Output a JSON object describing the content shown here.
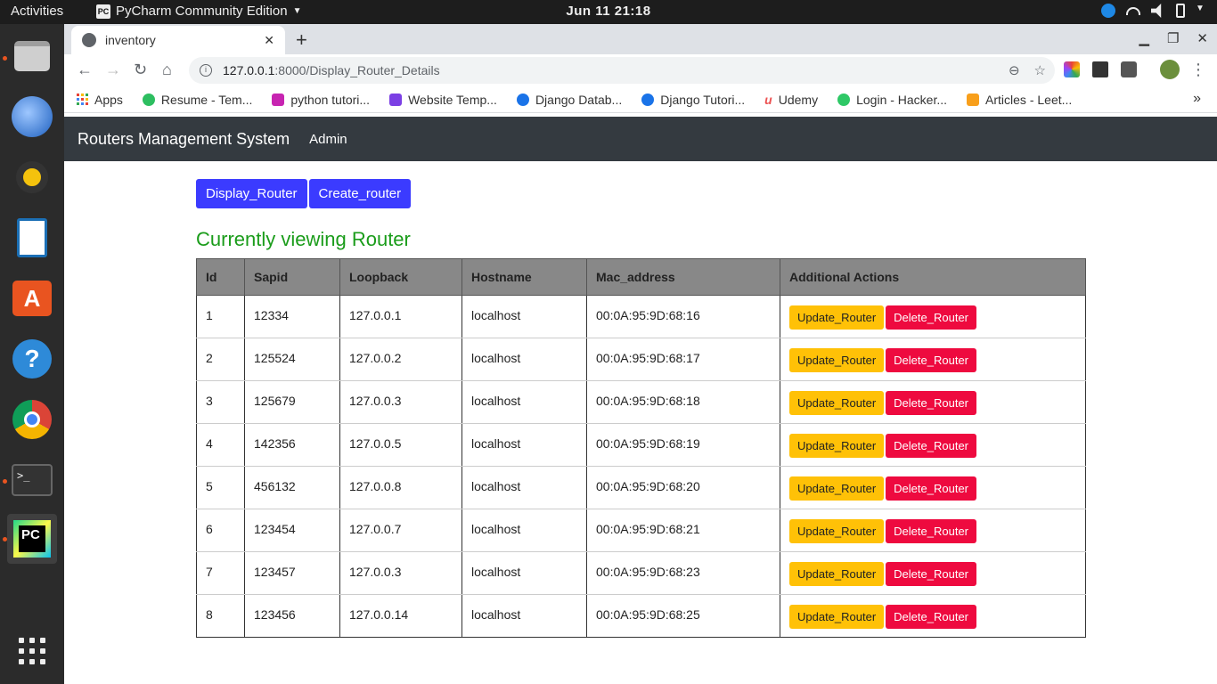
{
  "topbar": {
    "activities": "Activities",
    "app_name": "PyCharm Community Edition",
    "app_icon_text": "PC",
    "datetime": "Jun 11  21:18"
  },
  "browser": {
    "tab_title": "inventory",
    "url_host": "127.0.0.1",
    "url_path": ":8000/Display_Router_Details",
    "bookmarks": [
      {
        "label": "Apps",
        "color": "#e94235"
      },
      {
        "label": "Resume - Tem...",
        "color": "#2dbe60"
      },
      {
        "label": "python tutori...",
        "color": "#c724b1"
      },
      {
        "label": "Website Temp...",
        "color": "#7b3fe4"
      },
      {
        "label": "Django Datab...",
        "color": "#1a73e8"
      },
      {
        "label": "Django Tutori...",
        "color": "#1a73e8"
      },
      {
        "label": "Udemy",
        "color": "#ec5252"
      },
      {
        "label": "Login - Hacker...",
        "color": "#2ec866"
      },
      {
        "label": "Articles - Leet...",
        "color": "#f89f1b"
      }
    ]
  },
  "page": {
    "brand": "Routers Management System",
    "nav_admin": "Admin",
    "btn_display": "Display_Router",
    "btn_create": "Create_router",
    "heading": "Currently viewing Router",
    "columns": [
      "Id",
      "Sapid",
      "Loopback",
      "Hostname",
      "Mac_address",
      "Additional Actions"
    ],
    "update_label": "Update_Router",
    "delete_label": "Delete_Router",
    "rows": [
      {
        "id": "1",
        "sapid": "12334",
        "loopback": "127.0.0.1",
        "hostname": "localhost",
        "mac": "00:0A:95:9D:68:16"
      },
      {
        "id": "2",
        "sapid": "125524",
        "loopback": "127.0.0.2",
        "hostname": "localhost",
        "mac": "00:0A:95:9D:68:17"
      },
      {
        "id": "3",
        "sapid": "125679",
        "loopback": "127.0.0.3",
        "hostname": "localhost",
        "mac": "00:0A:95:9D:68:18"
      },
      {
        "id": "4",
        "sapid": "142356",
        "loopback": "127.0.0.5",
        "hostname": "localhost",
        "mac": "00:0A:95:9D:68:19"
      },
      {
        "id": "5",
        "sapid": "456132",
        "loopback": "127.0.0.8",
        "hostname": "localhost",
        "mac": "00:0A:95:9D:68:20"
      },
      {
        "id": "6",
        "sapid": "123454",
        "loopback": "127.0.0.7",
        "hostname": "localhost",
        "mac": "00:0A:95:9D:68:21"
      },
      {
        "id": "7",
        "sapid": "123457",
        "loopback": "127.0.0.3",
        "hostname": "localhost",
        "mac": "00:0A:95:9D:68:23"
      },
      {
        "id": "8",
        "sapid": "123456",
        "loopback": "127.0.0.14",
        "hostname": "localhost",
        "mac": "00:0A:95:9D:68:25"
      }
    ]
  },
  "colors": {
    "navbar": "#343a40",
    "primary": "#3b3bff",
    "heading": "#1a9c1a",
    "warning": "#ffc107",
    "danger": "#ee0a3f"
  }
}
